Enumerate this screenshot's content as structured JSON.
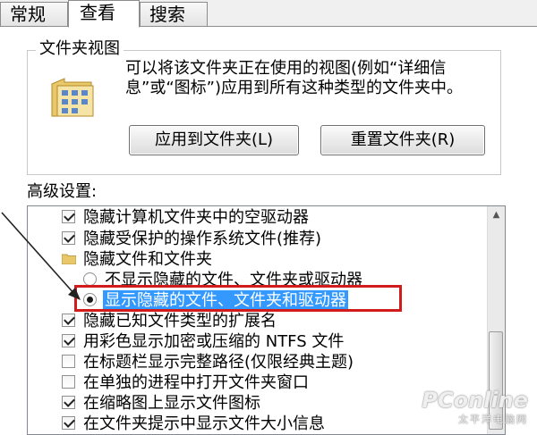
{
  "tabs": [
    {
      "label": "常规"
    },
    {
      "label": "查看"
    },
    {
      "label": "搜索"
    }
  ],
  "folder_views": {
    "title": "文件夹视图",
    "description": "可以将该文件夹正在使用的视图(例如“详细信息”或“图标”)应用到所有这种类型的文件夹中。",
    "apply_button": "应用到文件夹(L)",
    "reset_button": "重置文件夹(R)"
  },
  "advanced": {
    "label": "高级设置:",
    "items": [
      {
        "type": "checkbox",
        "checked": true,
        "label": "隐藏计算机文件夹中的空驱动器"
      },
      {
        "type": "checkbox",
        "checked": true,
        "label": "隐藏受保护的操作系统文件(推荐)"
      },
      {
        "type": "folder",
        "label": "隐藏文件和文件夹"
      },
      {
        "type": "radio",
        "checked": false,
        "label": "不显示隐藏的文件、文件夹或驱动器"
      },
      {
        "type": "radio",
        "checked": true,
        "label": "显示隐藏的文件、文件夹和驱动器"
      },
      {
        "type": "checkbox",
        "checked": true,
        "label": "隐藏已知文件类型的扩展名"
      },
      {
        "type": "checkbox",
        "checked": true,
        "label": "用彩色显示加密或压缩的 NTFS 文件"
      },
      {
        "type": "checkbox",
        "checked": false,
        "label": "在标题栏显示完整路径(仅限经典主题)"
      },
      {
        "type": "checkbox",
        "checked": false,
        "label": "在单独的进程中打开文件夹窗口"
      },
      {
        "type": "checkbox",
        "checked": true,
        "label": "在缩略图上显示文件图标"
      },
      {
        "type": "checkbox",
        "checked": true,
        "label": "在文件夹提示中显示文件大小信息"
      }
    ]
  },
  "watermark": {
    "main": "PConline",
    "sub": "太平洋电脑网"
  },
  "colors": {
    "selection": "#3399ff",
    "highlight_box": "#d21c1c"
  },
  "icons": {
    "folder_views": "folder-view-icon",
    "tree_folder": "folder-icon",
    "arrow": "annotation-arrow"
  }
}
